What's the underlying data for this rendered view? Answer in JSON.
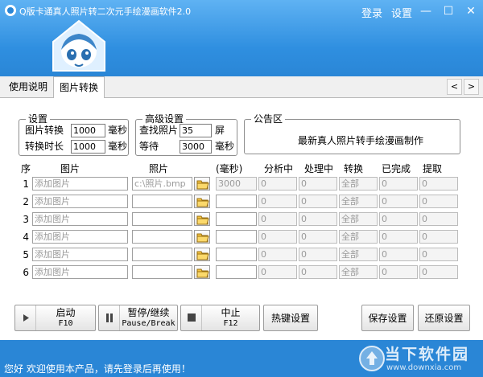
{
  "window": {
    "title": "Q版卡通真人照片转二次元手绘漫画软件2.0",
    "login": "登录",
    "settings": "设置",
    "minimize": "—",
    "maximize": "☐",
    "close": "✕"
  },
  "tabs": [
    {
      "label": "使用说明",
      "active": false
    },
    {
      "label": "图片转换",
      "active": true
    }
  ],
  "tab_nav": {
    "prev": "<",
    "next": ">"
  },
  "settings_group": {
    "title": "设置",
    "convert_label": "图片转换",
    "convert_value": "1000",
    "convert_unit": "毫秒",
    "duration_label": "转换时长",
    "duration_value": "1000",
    "duration_unit": "毫秒"
  },
  "advanced_group": {
    "title": "高级设置",
    "find_label": "查找照片",
    "find_value": "35",
    "find_unit": "屏",
    "wait_label": "等待",
    "wait_value": "3000",
    "wait_unit": "毫秒"
  },
  "notice_group": {
    "title": "公告区",
    "text": "最新真人照片转手绘漫画制作"
  },
  "table": {
    "headers": [
      "序",
      "图片",
      "照片",
      "(毫秒)",
      "分析中",
      "处理中",
      "转换",
      "已完成",
      "提取"
    ],
    "rows": [
      {
        "num": "1",
        "image": "添加图片",
        "photo": "c:\\照片.bmp",
        "ms": "3000",
        "analyzing": "0",
        "processing": "0",
        "convert": "全部",
        "done": "0",
        "extract": "0"
      },
      {
        "num": "2",
        "image": "添加图片",
        "photo": "",
        "ms": "",
        "analyzing": "0",
        "processing": "0",
        "convert": "全部",
        "done": "0",
        "extract": "0"
      },
      {
        "num": "3",
        "image": "添加图片",
        "photo": "",
        "ms": "",
        "analyzing": "0",
        "processing": "0",
        "convert": "全部",
        "done": "0",
        "extract": "0"
      },
      {
        "num": "4",
        "image": "添加图片",
        "photo": "",
        "ms": "",
        "analyzing": "0",
        "processing": "0",
        "convert": "全部",
        "done": "0",
        "extract": "0"
      },
      {
        "num": "5",
        "image": "添加图片",
        "photo": "",
        "ms": "",
        "analyzing": "0",
        "processing": "0",
        "convert": "全部",
        "done": "0",
        "extract": "0"
      },
      {
        "num": "6",
        "image": "添加图片",
        "photo": "",
        "ms": "",
        "analyzing": "0",
        "processing": "0",
        "convert": "全部",
        "done": "0",
        "extract": "0"
      }
    ]
  },
  "toolbar": {
    "start_label": "启动",
    "start_key": "F10",
    "pause_label": "暂停/继续",
    "pause_key": "Pause/Break",
    "stop_label": "中止",
    "stop_key": "F12",
    "hotkey_label": "热键设置",
    "save_label": "保存设置",
    "restore_label": "还原设置"
  },
  "status": {
    "text": "您好 欢迎使用本产品，请先登录后再使用！"
  },
  "watermark": {
    "brand": "当下软件园",
    "url": "www.downxia.com"
  }
}
